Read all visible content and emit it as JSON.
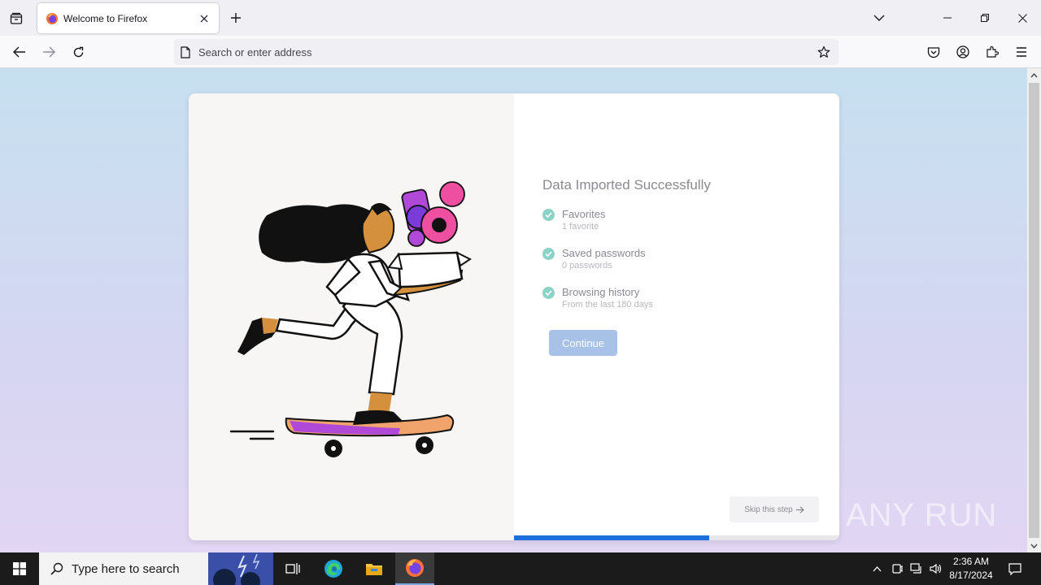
{
  "browser": {
    "tab": {
      "title": "Welcome to Firefox"
    },
    "urlbar": {
      "placeholder": "Search or enter address"
    }
  },
  "import": {
    "heading": "Data Imported Successfully",
    "items": [
      {
        "title": "Favorites",
        "subtitle": "1 favorite"
      },
      {
        "title": "Saved passwords",
        "subtitle": "0 passwords"
      },
      {
        "title": "Browsing history",
        "subtitle": "From the last 180 days"
      }
    ],
    "continue_label": "Continue",
    "skip_label": "Skip this step",
    "progress_fraction": 0.6
  },
  "watermark": {
    "text": "ANY RUN"
  },
  "taskbar": {
    "search_placeholder": "Type here to search",
    "time": "2:36 AM",
    "date": "8/17/2024"
  },
  "colors": {
    "accent": "#1d6fe0",
    "check": "#8ad3c6",
    "continue_bg": "#a7c2e6"
  }
}
